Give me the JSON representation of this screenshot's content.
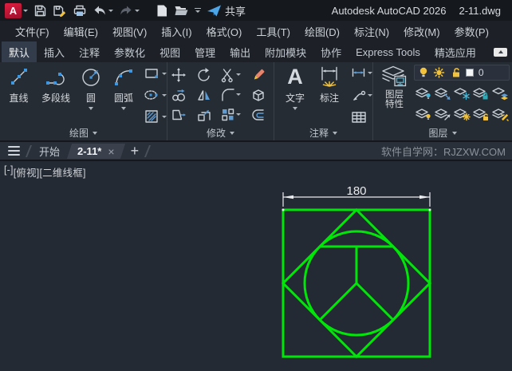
{
  "app": {
    "logo_letter": "A",
    "title_app": "Autodesk AutoCAD 2026",
    "title_doc": "2-11.dwg",
    "share_label": "共享"
  },
  "menubar": {
    "items": [
      {
        "label": "文件(F)"
      },
      {
        "label": "编辑(E)"
      },
      {
        "label": "视图(V)"
      },
      {
        "label": "插入(I)"
      },
      {
        "label": "格式(O)"
      },
      {
        "label": "工具(T)"
      },
      {
        "label": "绘图(D)"
      },
      {
        "label": "标注(N)"
      },
      {
        "label": "修改(M)"
      },
      {
        "label": "参数(P)"
      }
    ]
  },
  "ribbon": {
    "tabs": [
      {
        "label": "默认",
        "active": true
      },
      {
        "label": "插入"
      },
      {
        "label": "注释"
      },
      {
        "label": "参数化"
      },
      {
        "label": "视图"
      },
      {
        "label": "管理"
      },
      {
        "label": "输出"
      },
      {
        "label": "附加模块"
      },
      {
        "label": "协作"
      },
      {
        "label": "Express Tools"
      },
      {
        "label": "精选应用"
      }
    ],
    "draw_panel": {
      "label": "绘图",
      "line_label": "直线",
      "polyline_label": "多段线",
      "circle_label": "圆",
      "arc_label": "圆弧"
    },
    "modify_panel": {
      "label": "修改"
    },
    "annotate_panel": {
      "label": "注释",
      "text_label": "文字",
      "text_icon_glyph": "A",
      "dim_label": "标注"
    },
    "layer_panel": {
      "label": "图层",
      "properties_label_line1": "图层",
      "properties_label_line2": "特性",
      "current_layer": "0"
    }
  },
  "doctabs": {
    "start_tab": "开始",
    "active_tab": "2-11*",
    "close_glyph": "×",
    "new_tab_glyph": "+",
    "watermark": "软件自学网：RJZXW.COM"
  },
  "canvas": {
    "viewport_minimize": "[-]",
    "viewport_view": "[俯视]",
    "viewport_visual_style": "[二维线框]",
    "dimension_value": "180"
  },
  "colors": {
    "geometry_green": "#00e608",
    "dimension_white": "#e9ebee",
    "accent_blue": "#5e9cd3",
    "accent_yellow": "#f0c23e"
  }
}
